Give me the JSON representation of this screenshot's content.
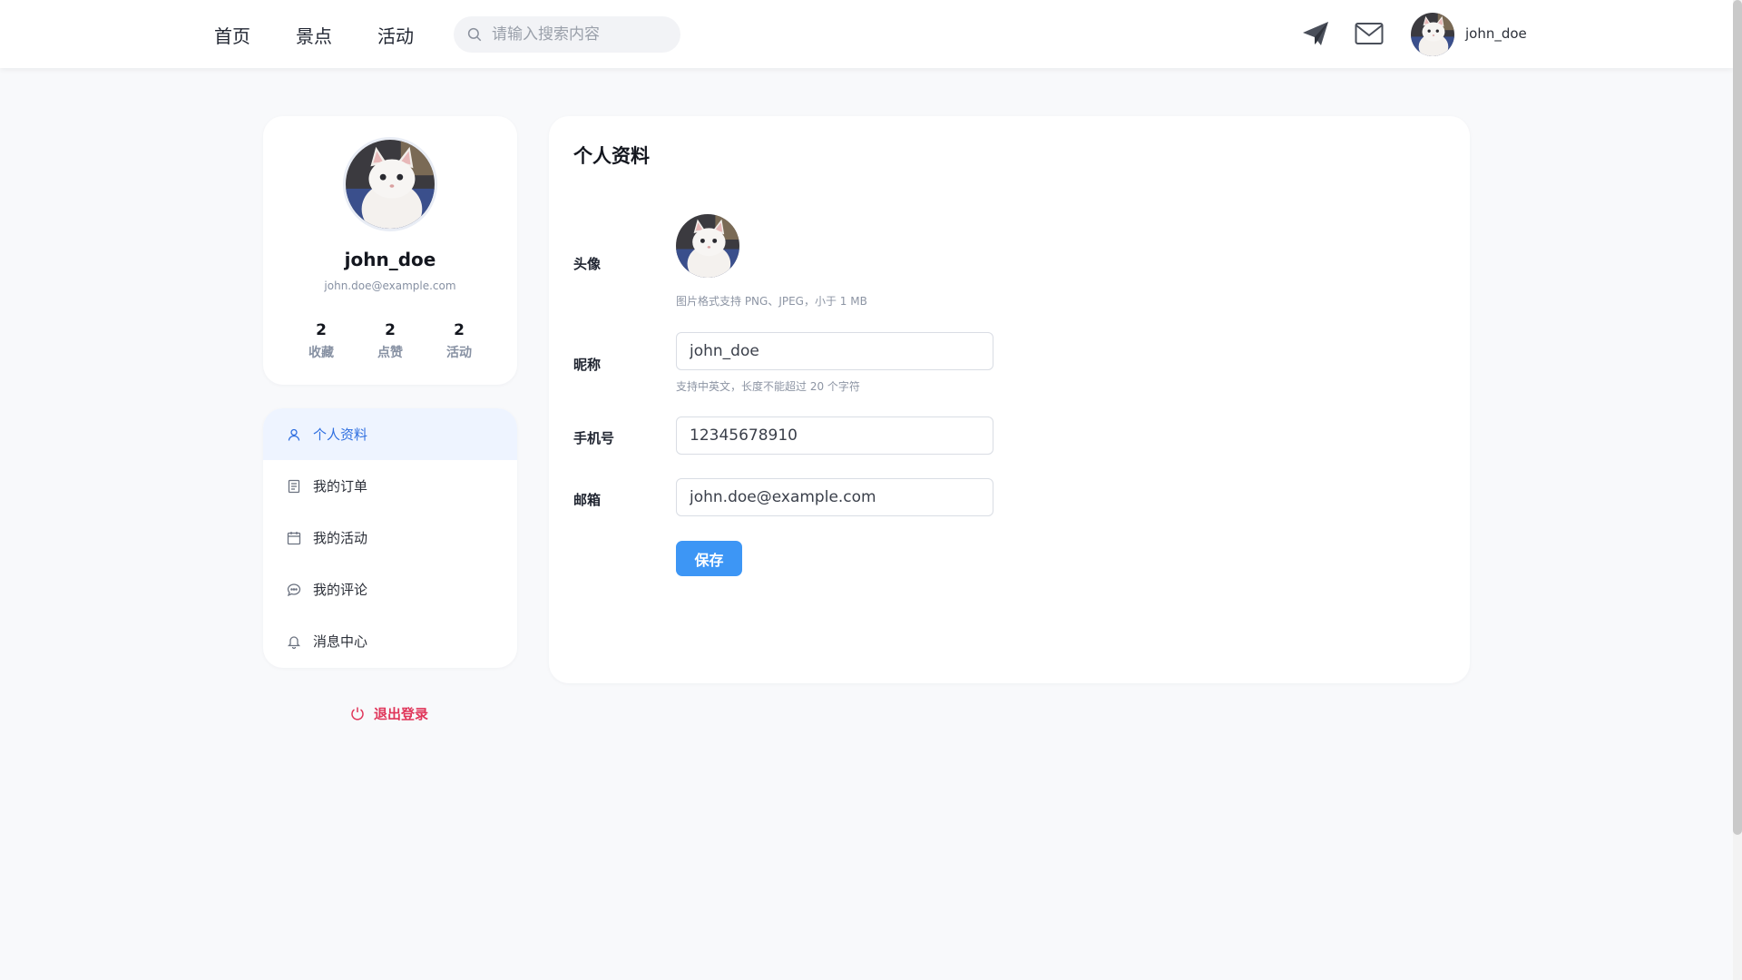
{
  "nav": {
    "links": [
      "首页",
      "景点",
      "活动"
    ],
    "search_placeholder": "请输入搜索内容"
  },
  "user": {
    "username": "john_doe",
    "email": "john.doe@example.com"
  },
  "profile_stats": [
    {
      "count": "2",
      "label": "收藏"
    },
    {
      "count": "2",
      "label": "点赞"
    },
    {
      "count": "2",
      "label": "活动"
    }
  ],
  "sidebar": {
    "items": [
      {
        "label": "个人资料",
        "icon": "user-icon",
        "active": true
      },
      {
        "label": "我的订单",
        "icon": "document-icon",
        "active": false
      },
      {
        "label": "我的活动",
        "icon": "calendar-icon",
        "active": false
      },
      {
        "label": "我的评论",
        "icon": "chat-icon",
        "active": false
      },
      {
        "label": "消息中心",
        "icon": "bell-icon",
        "active": false
      }
    ],
    "logout_label": "退出登录"
  },
  "form": {
    "title": "个人资料",
    "avatar_label": "头像",
    "avatar_hint": "图片格式支持 PNG、JPEG，小于 1 MB",
    "nickname_label": "昵称",
    "nickname_value": "john_doe",
    "nickname_hint": "支持中英文，长度不能超过 20 个字符",
    "phone_label": "手机号",
    "phone_value": "12345678910",
    "email_label": "邮箱",
    "email_value": "john.doe@example.com",
    "save_label": "保存"
  },
  "colors": {
    "accent": "#3d96f5",
    "active_text": "#2f6fe0",
    "active_bg": "#eef4ff",
    "danger": "#e0365a",
    "page_bg": "#f8f9fb"
  }
}
